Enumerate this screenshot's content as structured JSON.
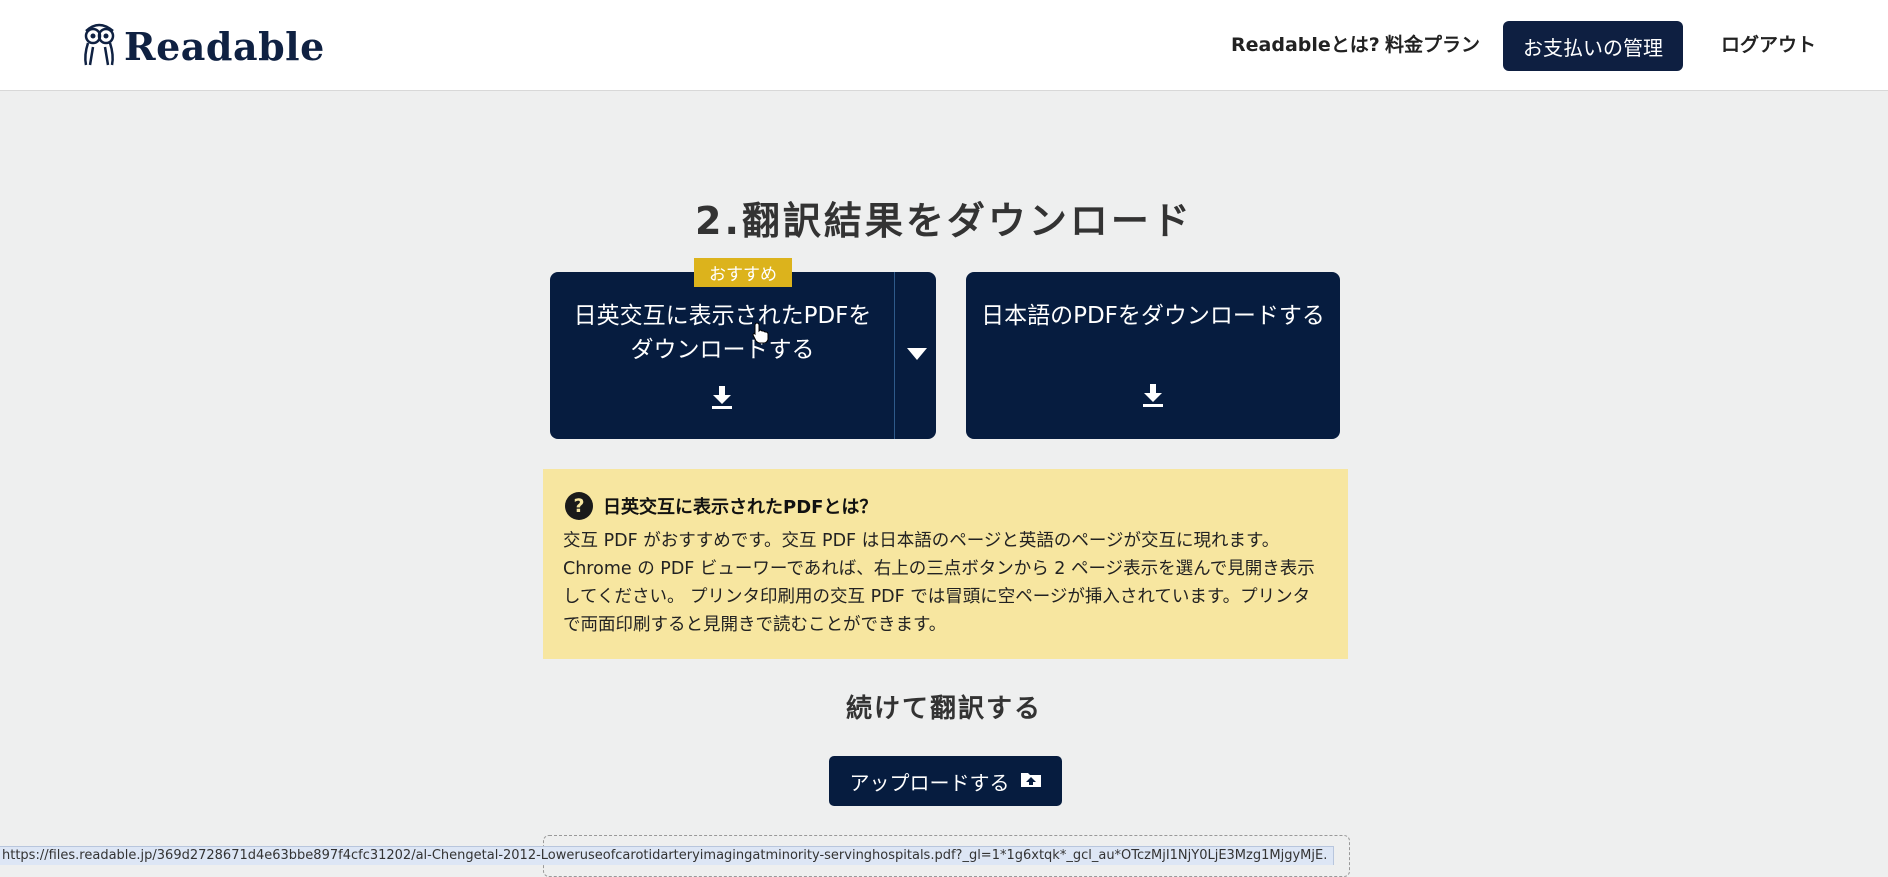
{
  "header": {
    "logo_text": "Readable",
    "nav": {
      "about": "Readableとは?",
      "pricing": "料金プラン",
      "billing": "お支払いの管理",
      "logout": "ログアウト"
    }
  },
  "main": {
    "title": "2.翻訳結果をダウンロード",
    "recommend_badge": "おすすめ",
    "download_bilingual": {
      "line1": "日英交互に表示されたPDFを",
      "line2": "ダウンロードする"
    },
    "download_japanese": "日本語のPDFをダウンロードする",
    "info": {
      "title": "日英交互に表示されたPDFとは？",
      "line1": "交互 PDF がおすすめです。交互 PDF は日本語のページと英語のページが交互に現れます。",
      "line2": "Chrome の PDF ビューワーであれば、右上の三点ボタンから 2 ページ表示を選んで見開き表示",
      "line3": "してください。 プリンタ印刷用の交互 PDF では冒頭に空ページが挿入されています。プリンタ",
      "line4": "で両面印刷すると見開きで読むことができます。"
    },
    "continue_title": "続けて翻訳する",
    "upload_label": "アップロードする"
  },
  "status_url": "https://files.readable.jp/369d2728671d4e63bbe897f4cfc31202/al-Chengetal-2012-Loweruseofcarotidarteryimagingatminority-servinghospitals.pdf?_gl=1*1g6xtqk*_gcl_au*OTczMjI1NjY0LjE3Mzg1MjgyMjE.",
  "colors": {
    "navy": "#061c3f",
    "badge": "#dcb31c",
    "info_bg": "#f7e6a0",
    "page_bg": "#eeefef"
  },
  "icons": [
    "owl-logo-icon",
    "download-icon",
    "chevron-down-icon",
    "question-icon",
    "upload-folder-icon",
    "hand-cursor-icon"
  ]
}
